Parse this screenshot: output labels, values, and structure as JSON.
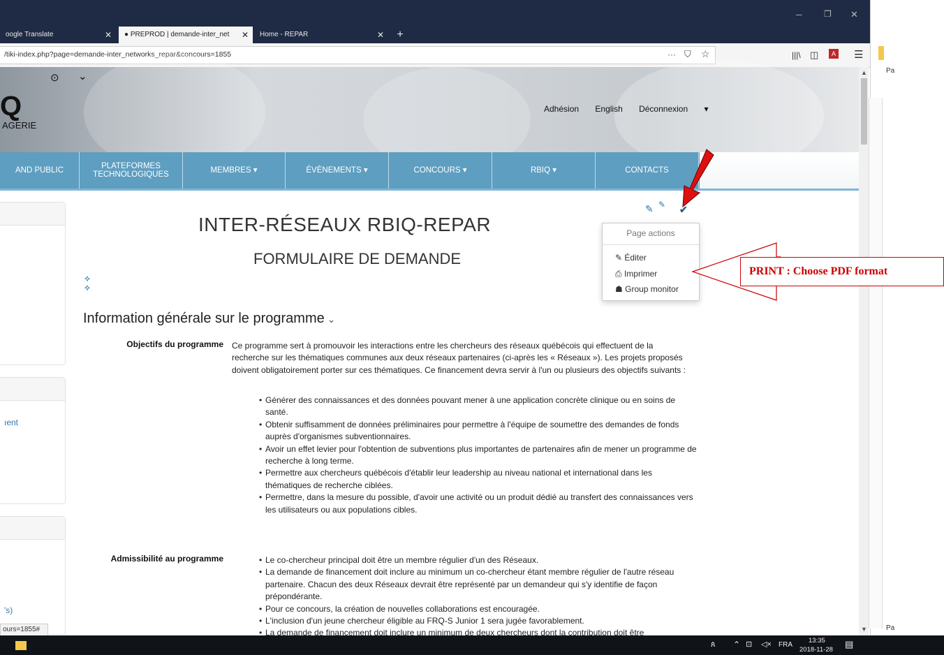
{
  "browser": {
    "tabs": [
      {
        "label": "oogle Translate"
      },
      {
        "label": "PREPROD | demande-inter_net"
      },
      {
        "label": "Home - REPAR"
      }
    ],
    "new_tab": "+",
    "url": "/tiki-index.php?page=demande-inter_networks_repar&concours=1855",
    "url_actions": "···",
    "right_pane_text": "Pa",
    "right_pane_bottom": "Pa"
  },
  "header": {
    "logo_char": "Q",
    "logo_text": "AGERIE",
    "nav": {
      "adhesion": "Adhésion",
      "english": "English",
      "logout": "Déconnexion"
    }
  },
  "menu": {
    "items": [
      {
        "label": "AND PUBLIC"
      },
      {
        "label": "PLATEFORMES TECHNOLOGIQUES"
      },
      {
        "label": "MEMBRES"
      },
      {
        "label": "ÉVÈNEMENTS"
      },
      {
        "label": "CONCOURS"
      },
      {
        "label": "RBIQ"
      },
      {
        "label": "CONTACTS"
      }
    ]
  },
  "sidebar": {
    "link1": "ıent",
    "link2": "'s)"
  },
  "page": {
    "title": "INTER-RÉSEAUX RBIQ-REPAR",
    "subtitle": "FORMULAIRE DE DEMANDE",
    "section_title": "Information générale sur le programme",
    "objectives_label": "Objectifs du programme",
    "objectives_intro": "Ce programme sert à promouvoir les interactions entre les chercheurs des réseaux québécois qui effectuent de la recherche sur les thématiques communes aux deux réseaux partenaires (ci-après les « Réseaux »). Les projets proposés doivent obligatoirement porter sur ces thématiques. Ce financement devra servir à l'un ou plusieurs des objectifs suivants :",
    "objectives": [
      "Générer des connaissances et des données pouvant mener à une application concrète clinique ou en soins de santé.",
      "Obtenir suffisamment de données préliminaires pour permettre à l'équipe de soumettre des demandes de fonds auprès d'organismes subventionnaires.",
      "Avoir un effet levier pour l'obtention de subventions plus importantes de partenaires afin de mener un programme de recherche à long terme.",
      "Permettre aux chercheurs québécois d'établir leur leadership au niveau national et international dans les thématiques de recherche ciblées.",
      "Permettre, dans la mesure du possible, d'avoir une activité ou un produit dédié au transfert des connaissances vers les utilisateurs ou aux populations cibles."
    ],
    "eligibility_label": "Admissibilité au programme",
    "eligibility": [
      "Le co-chercheur principal doit être un membre régulier d'un des Réseaux.",
      "La demande de financement doit inclure au minimum un co-chercheur étant membre régulier de l'autre réseau partenaire. Chacun des deux Réseaux devrait être représenté par un demandeur qui s'y identifie de façon prépondérante.",
      "Pour ce concours, la création de nouvelles collaborations est encouragée.",
      "L'inclusion d'un jeune chercheur éligible au FRQ-S Junior 1 sera jugée favorablement.",
      "La demande de financement doit inclure un minimum de deux chercheurs dont la contribution doit être"
    ]
  },
  "page_actions": {
    "header": "Page actions",
    "edit": "Éditer",
    "print": "Imprimer",
    "group_monitor": "Group monitor"
  },
  "annotation": {
    "text": "PRINT : Choose PDF format",
    "color": "#cc0000"
  },
  "status_url": "ours=1855#",
  "taskbar": {
    "lang": "FRA",
    "time": "13:35",
    "date": "2018-11-28"
  },
  "colors": {
    "menu": "#5e9ec0",
    "tabbar": "#1f2a44",
    "link": "#2a7ab0"
  }
}
